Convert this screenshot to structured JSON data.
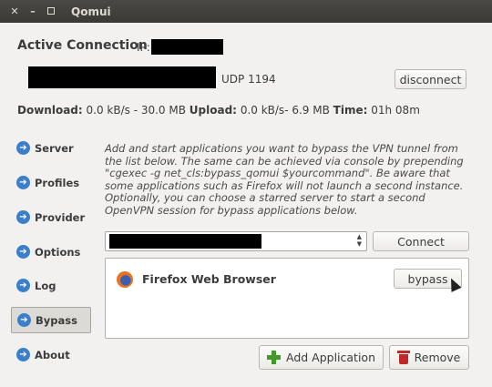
{
  "window": {
    "title": "Qomui",
    "close_glyph": "✕",
    "minimize_glyph": "–"
  },
  "header": {
    "active_connection_label": "Active Connection",
    "ip_label": "IP:",
    "protocol": "UDP 1194",
    "disconnect_label": "disconnect"
  },
  "stats": {
    "download_label": "Download:",
    "download_value": "0.0 kB/s - 30.0 MB",
    "upload_label": "Upload:",
    "upload_value": "0.0 kB/s- 6.9 MB",
    "time_label": "Time:",
    "time_value": "01h 08m"
  },
  "sidebar": {
    "items": [
      {
        "label": "Server"
      },
      {
        "label": "Profiles"
      },
      {
        "label": "Provider"
      },
      {
        "label": "Options"
      },
      {
        "label": "Log"
      },
      {
        "label": "Bypass"
      },
      {
        "label": "About"
      }
    ],
    "active": "Bypass"
  },
  "bypass": {
    "info": "Add and start applications you want to bypass the VPN tunnel from the list below. The same can be achieved via console by prepending \"cgexec -g net_cls:bypass_qomui $yourcommand\". Be aware that some applications such as Firefox will not launch a second instance. Optionally, you can choose a starred server to start a second OpenVPN session for bypass applications below.",
    "connect_label": "Connect",
    "apps": [
      {
        "name": "Firefox Web Browser",
        "button": "bypass"
      }
    ],
    "add_label": "Add Application",
    "remove_label": "Remove"
  },
  "colors": {
    "titlebar": "#3c3b37",
    "accent": "#3b7fcb",
    "add_green": "#3f9a2a",
    "remove_red": "#c0282a"
  },
  "icons": {
    "side": "arrow-circle-icon",
    "app": "firefox-icon",
    "add": "plus-icon",
    "remove": "trash-icon"
  }
}
